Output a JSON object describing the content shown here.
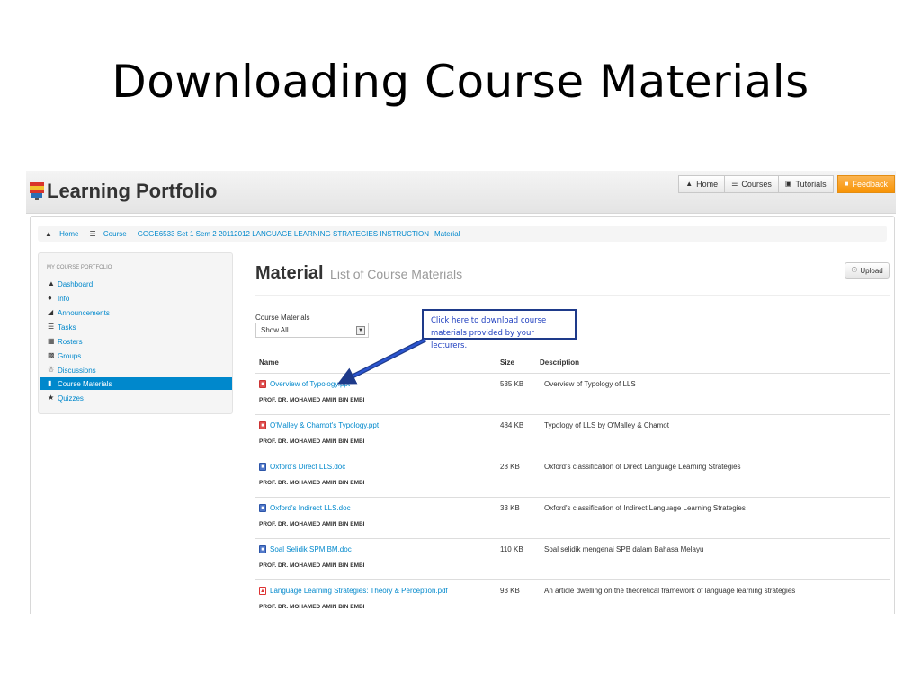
{
  "slide": {
    "title": "Downloading Course Materials"
  },
  "app": {
    "brand": "Learning Portfolio",
    "topnav": [
      {
        "label": "Home",
        "icon": "home-icon"
      },
      {
        "label": "Courses",
        "icon": "list-icon"
      },
      {
        "label": "Tutorials",
        "icon": "book-icon"
      },
      {
        "label": "Feedback",
        "icon": "comment-icon"
      }
    ],
    "colors": {
      "accent": "#0088cc",
      "feedback": "#f89406",
      "callout_border": "#1e3a8a"
    }
  },
  "breadcrumb": {
    "home": "Home",
    "course": "Course",
    "course_name": "GGGE6533 Set 1 Sem 2 20112012 LANGUAGE LEARNING STRATEGIES INSTRUCTION",
    "current": "Material"
  },
  "sidebar": {
    "header": "MY COURSE PORTFOLIO",
    "items": [
      {
        "label": "Dashboard",
        "icon": "home-icon"
      },
      {
        "label": "Info",
        "icon": "info-icon"
      },
      {
        "label": "Announcements",
        "icon": "signal-icon"
      },
      {
        "label": "Tasks",
        "icon": "list-icon"
      },
      {
        "label": "Rosters",
        "icon": "calendar-icon"
      },
      {
        "label": "Groups",
        "icon": "grid-icon"
      },
      {
        "label": "Discussions",
        "icon": "user-icon"
      },
      {
        "label": "Course Materials",
        "icon": "file-icon",
        "active": true
      },
      {
        "label": "Quizzes",
        "icon": "star-icon"
      }
    ]
  },
  "main": {
    "heading": "Material",
    "subheading": "List of Course Materials",
    "upload_label": "Upload",
    "filter_label": "Course Materials",
    "filter_value": "Show All",
    "callout": "Click here to download course materials provided by your lecturers.",
    "columns": {
      "name": "Name",
      "size": "Size",
      "description": "Description"
    },
    "files": [
      {
        "name": "Overview of Typology.ppt",
        "type": "ppt",
        "author": "PROF. DR. MOHAMED AMIN BIN EMBI",
        "size": "535 KB",
        "description": "Overview of Typology of LLS"
      },
      {
        "name": "O'Malley & Chamot's Typology.ppt",
        "type": "ppt",
        "author": "PROF. DR. MOHAMED AMIN BIN EMBI",
        "size": "484 KB",
        "description": "Typology of LLS by O'Malley & Chamot"
      },
      {
        "name": "Oxford's Direct LLS.doc",
        "type": "doc",
        "author": "PROF. DR. MOHAMED AMIN BIN EMBI",
        "size": "28 KB",
        "description": "Oxford's classification of Direct Language Learning Strategies"
      },
      {
        "name": "Oxford's Indirect LLS.doc",
        "type": "doc",
        "author": "PROF. DR. MOHAMED AMIN BIN EMBI",
        "size": "33 KB",
        "description": "Oxford's classification of Indirect Language Learning Strategies"
      },
      {
        "name": "Soal Selidik SPM BM.doc",
        "type": "doc",
        "author": "PROF. DR. MOHAMED AMIN BIN EMBI",
        "size": "110 KB",
        "description": "Soal selidik mengenai SPB dalam Bahasa Melayu"
      },
      {
        "name": "Language Learning Strategies: Theory & Perception.pdf",
        "type": "pdf",
        "author": "PROF. DR. MOHAMED AMIN BIN EMBI",
        "size": "93 KB",
        "description": "An article dwelling on the theoretical framework of language learning strategies"
      }
    ]
  }
}
